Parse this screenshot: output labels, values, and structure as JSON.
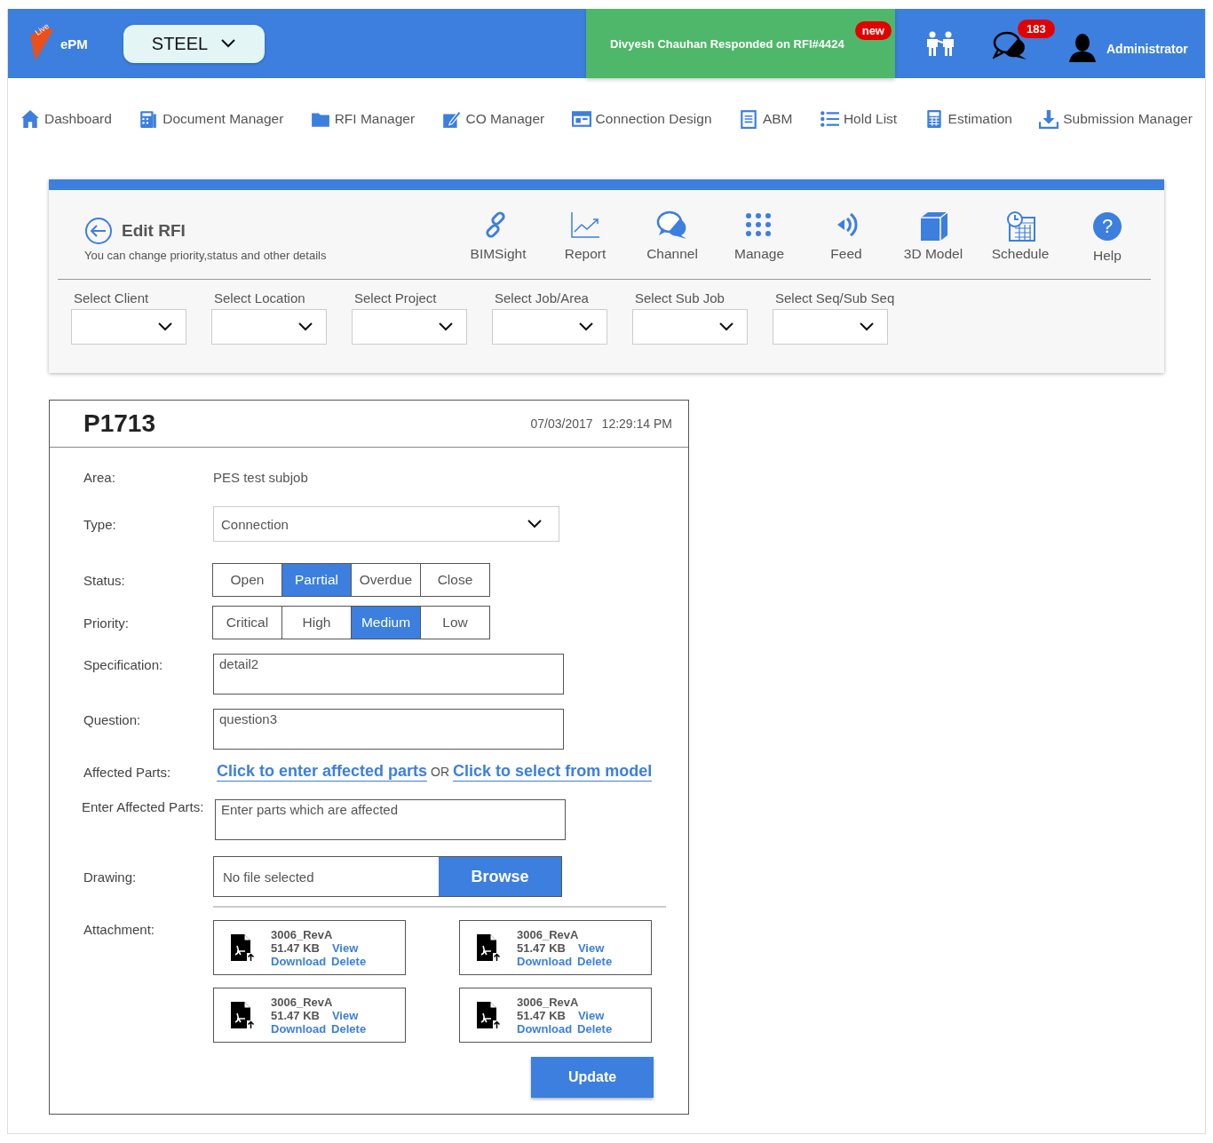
{
  "header": {
    "logo_badge": "Live",
    "logo_text": "ePM",
    "division": "STEEL",
    "notification": {
      "text": "Divyesh Chauhan Responded on RFI#4424",
      "badge": "new"
    },
    "messages_count": "183",
    "user": "Administrator"
  },
  "nav": [
    {
      "label": "Dashboard"
    },
    {
      "label": "Document Manager"
    },
    {
      "label": "RFI Manager"
    },
    {
      "label": "CO Manager"
    },
    {
      "label": "Connection Design"
    },
    {
      "label": "ABM"
    },
    {
      "label": "Hold List"
    },
    {
      "label": "Estimation"
    },
    {
      "label": "Submission Manager"
    }
  ],
  "page": {
    "title": "Edit RFI",
    "subtitle": "You can change priority,status and other details"
  },
  "tools": [
    {
      "label": "BIMSight"
    },
    {
      "label": "Report"
    },
    {
      "label": "Channel"
    },
    {
      "label": "Manage"
    },
    {
      "label": "Feed"
    },
    {
      "label": "3D Model"
    },
    {
      "label": "Schedule"
    },
    {
      "label": "Help",
      "glyph": "?"
    }
  ],
  "filters": [
    {
      "label": "Select Client"
    },
    {
      "label": "Select Location"
    },
    {
      "label": "Select Project"
    },
    {
      "label": "Select Job/Area"
    },
    {
      "label": "Select Sub Job"
    },
    {
      "label": "Select Seq/Sub Seq"
    }
  ],
  "rfi": {
    "number": "P1713",
    "date": "07/03/2017",
    "time": "12:29:14 PM",
    "area": {
      "label": "Area:",
      "value": "PES test subjob"
    },
    "type": {
      "label": "Type:",
      "value": "Connection"
    },
    "status": {
      "label": "Status:",
      "options": [
        {
          "label": "Open",
          "selected": false
        },
        {
          "label": "Parrtial",
          "selected": true
        },
        {
          "label": "Overdue",
          "selected": false
        },
        {
          "label": "Close",
          "selected": false
        }
      ]
    },
    "priority": {
      "label": "Priority:",
      "options": [
        {
          "label": "Critical",
          "selected": false
        },
        {
          "label": "High",
          "selected": false
        },
        {
          "label": "Medium",
          "selected": true
        },
        {
          "label": "Low",
          "selected": false
        }
      ]
    },
    "specification": {
      "label": "Specification:",
      "value": "detail2"
    },
    "question": {
      "label": "Question:",
      "value": "question3"
    },
    "affected_parts": {
      "label": "Affected Parts:",
      "link_enter": "Click to enter affected parts",
      "separator": "OR",
      "link_model": "Click to select from model"
    },
    "enter_affected_parts": {
      "label": "Enter Affected Parts:",
      "placeholder": "Enter parts which are affected"
    },
    "drawing": {
      "label": "Drawing:",
      "file_text": "No file selected",
      "button": "Browse"
    },
    "attachment_label": "Attachment:",
    "attachments": [
      {
        "name": "3006_RevA",
        "size": "51.47 KB",
        "view": "View",
        "download": "Download",
        "delete": "Delete"
      },
      {
        "name": "3006_RevA",
        "size": "51.47 KB",
        "view": "View",
        "download": "Download",
        "delete": "Delete"
      },
      {
        "name": "3006_RevA",
        "size": "51.47 KB",
        "view": "View",
        "download": "Download",
        "delete": "Delete"
      },
      {
        "name": "3006_RevA",
        "size": "51.47 KB",
        "view": "View",
        "download": "Download",
        "delete": "Delete"
      }
    ],
    "update_button": "Update"
  }
}
